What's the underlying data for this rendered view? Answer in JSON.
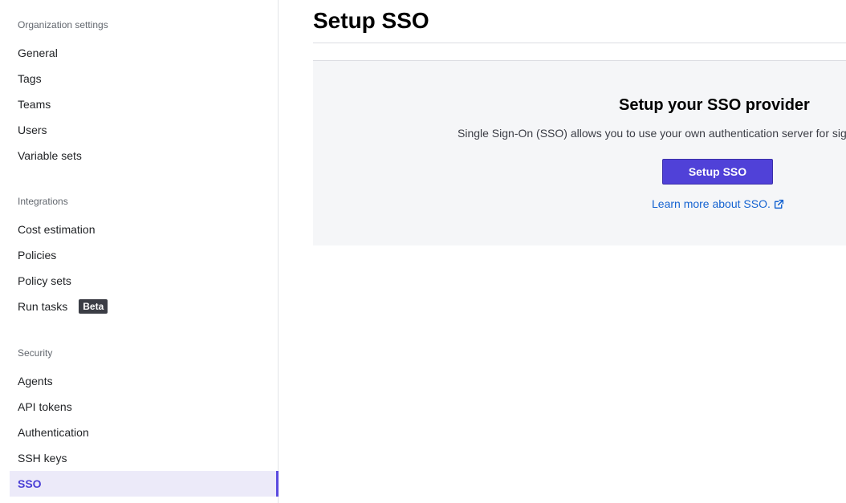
{
  "sidebar": {
    "sections": [
      {
        "title": "Organization settings",
        "items": [
          "General",
          "Tags",
          "Teams",
          "Users",
          "Variable sets"
        ]
      },
      {
        "title": "Integrations",
        "items": [
          "Cost estimation",
          "Policies",
          "Policy sets",
          "Run tasks"
        ],
        "badge": "Beta"
      },
      {
        "title": "Security",
        "items": [
          "Agents",
          "API tokens",
          "Authentication",
          "SSH keys",
          "SSO"
        ],
        "active": "SSO"
      }
    ]
  },
  "main": {
    "title": "Setup SSO",
    "panel": {
      "title": "Setup your SSO provider",
      "description": "Single Sign-On (SSO) allows you to use your own authentication server for sig",
      "button_label": "Setup SSO",
      "link_text": "Learn more about SSO.",
      "link_icon": "external-link-icon"
    }
  },
  "colors": {
    "accent": "#5041d8",
    "active_bg": "#eceaf9",
    "link": "#1563d1",
    "panel_bg": "#f5f6f8"
  }
}
